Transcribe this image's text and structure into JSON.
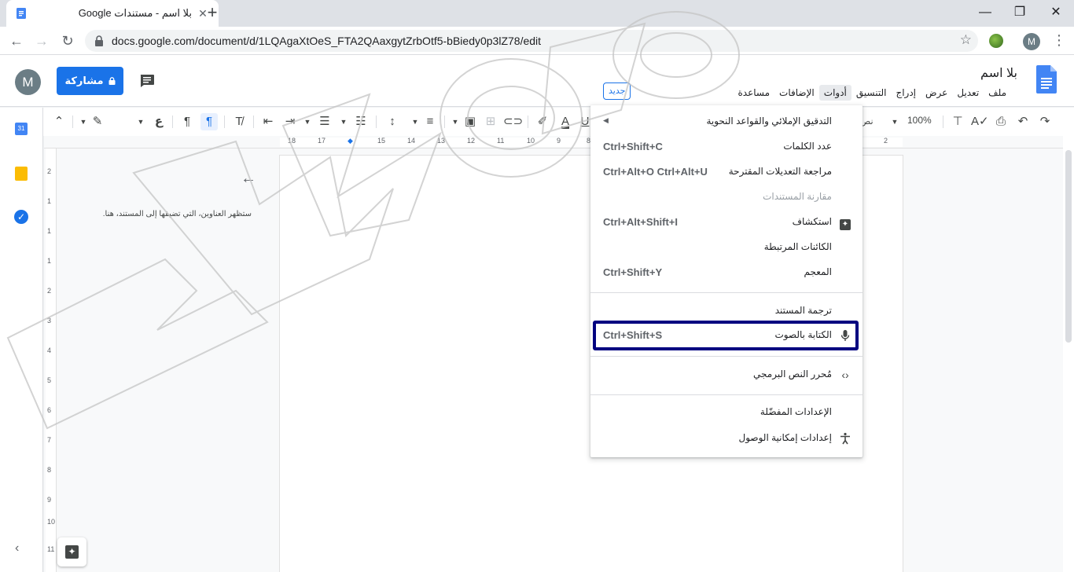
{
  "browser": {
    "tab_title": "بلا اسم - مستندات Google",
    "tab_close": "✕",
    "new_tab": "+",
    "url": "docs.google.com/document/d/1LQAgaXtOeS_FTA2QAaxgytZrbOtf5-bBiedy0p3lZ78/edit",
    "profile_initial": "M",
    "window_controls": {
      "minimize": "—",
      "restore": "❐",
      "close": "✕"
    }
  },
  "docs": {
    "title": "بلا اسم",
    "menus": [
      "ملف",
      "تعديل",
      "عرض",
      "إدراج",
      "التنسيق",
      "أدوات",
      "الإضافات",
      "مساعدة"
    ],
    "active_menu": "أدوات",
    "share_label": "مشاركة",
    "user_initial": "M",
    "zoom": "100%"
  },
  "outline": {
    "hint": "ستظهر العناوين، التي تضيفها إلى المستند، هنا."
  },
  "ruler": {
    "h_numbers": [
      "18",
      "17",
      "16",
      "15",
      "14",
      "13",
      "12",
      "11",
      "10",
      "9",
      "8",
      "2"
    ],
    "v_numbers": [
      "2",
      "1",
      "1",
      "1",
      "2",
      "3",
      "4",
      "5",
      "6",
      "7",
      "8",
      "9",
      "10",
      "11"
    ]
  },
  "tools_menu": {
    "items": [
      {
        "label": "التدقيق الإملائي والقواعد النحوية",
        "shortcut": "",
        "submenu": true,
        "icon": ""
      },
      {
        "label": "عدد الكلمات",
        "shortcut": "Ctrl+Shift+C",
        "icon": ""
      },
      {
        "label": "مراجعة التعديلات المقترحة",
        "shortcut": "Ctrl+Alt+O Ctrl+Alt+U",
        "icon": ""
      },
      {
        "label": "مقارنة المستندات",
        "badge": "جديد",
        "disabled": true,
        "icon": ""
      },
      {
        "label": "استكشاف",
        "shortcut": "Ctrl+Alt+Shift+I",
        "icon": "explore-icon"
      },
      {
        "label": "الكائنات المرتبطة",
        "shortcut": "",
        "icon": ""
      },
      {
        "label": "المعجم",
        "shortcut": "Ctrl+Shift+Y",
        "icon": ""
      },
      {
        "label": "ترجمة المستند",
        "shortcut": "",
        "icon": ""
      },
      {
        "label": "الكتابة بالصوت",
        "shortcut": "Ctrl+Shift+S",
        "icon": "microphone-icon",
        "highlighted": true
      },
      {
        "label": "مُحرر النص البرمجي",
        "shortcut": "",
        "icon": "code-icon"
      },
      {
        "label": "الإعدادات المفضّلة",
        "shortcut": "",
        "icon": ""
      },
      {
        "label": "إعدادات إمكانية الوصول",
        "shortcut": "",
        "icon": "accessibility-icon"
      }
    ]
  },
  "colors": {
    "accent": "#1a73e8",
    "highlight_border": "#000080",
    "docs_blue": "#4285f4"
  }
}
